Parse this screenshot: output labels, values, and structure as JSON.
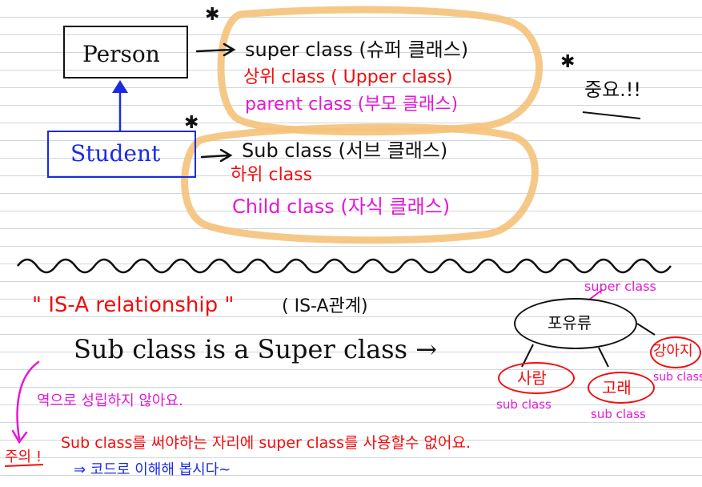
{
  "classes": {
    "person": "Person",
    "student": "Student"
  },
  "upper": {
    "line1": "super class (슈퍼 클래스)",
    "line2": "상위 class ( Upper class)",
    "line3": "parent class (부모 클래스)"
  },
  "lower": {
    "line1": "Sub class (서브 클래스)",
    "line2": "하위 class",
    "line3": "Child class (자식 클래스)"
  },
  "memo": "중요.!!",
  "relationship": {
    "title": "\" IS-A relationship \"",
    "title_ko": "( IS-A관계)",
    "sentence": "Sub class is a Super class →",
    "note": "역으로 성립하지 않아요.",
    "caution": "주의 !",
    "rule": "Sub class를 써야하는 자리에 super class를 사용할수 없어요.",
    "followup": "⇒ 코드로 이해해 봅시다~"
  },
  "tree": {
    "super_label": "super class",
    "root": "포유류",
    "children": [
      {
        "name": "사람",
        "label": "sub class"
      },
      {
        "name": "고래",
        "label": "sub class"
      },
      {
        "name": "강아지",
        "label": "sub class"
      }
    ]
  },
  "colors": {
    "ink_black": "#111111",
    "ink_red": "#f20d0d",
    "ink_magenta": "#e418d6",
    "ink_blue": "#1c2be0",
    "highlight_orange": "#f5c27a",
    "ruled_line": "#cfd6de"
  }
}
